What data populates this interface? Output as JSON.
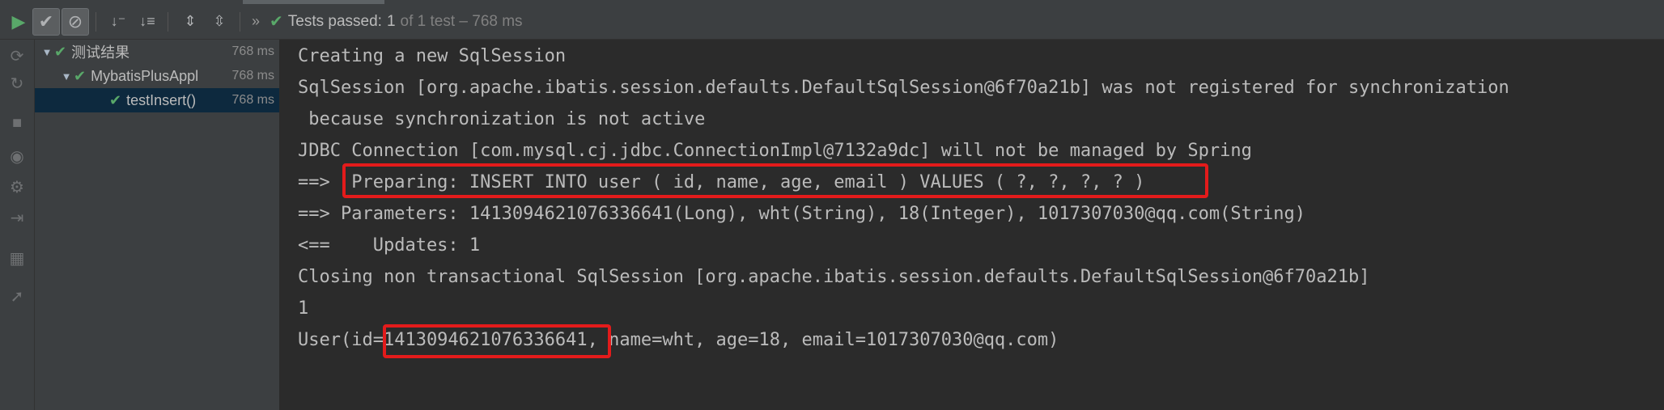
{
  "toolbar": {
    "summary_prefix": "Tests passed: ",
    "passed_count": "1",
    "summary_rest": "of 1 test – 768 ms",
    "chevron": "»"
  },
  "tree": [
    {
      "label": "测试结果",
      "time": "768 ms",
      "indent": 0,
      "expanded": true
    },
    {
      "label": "MybatisPlusAppl",
      "time": "768 ms",
      "indent": 1,
      "expanded": true
    },
    {
      "label": "testInsert()",
      "time": "768 ms",
      "indent": 2,
      "selected": true
    }
  ],
  "console": {
    "lines": [
      "Creating a new SqlSession",
      "SqlSession [org.apache.ibatis.session.defaults.DefaultSqlSession@6f70a21b] was not registered for synchronization",
      " because synchronization is not active",
      "JDBC Connection [com.mysql.cj.jdbc.ConnectionImpl@7132a9dc] will not be managed by Spring",
      "==>  Preparing: INSERT INTO user ( id, name, age, email ) VALUES ( ?, ?, ?, ? )",
      "==> Parameters: 1413094621076336641(Long), wht(String), 18(Integer), 1017307030@qq.com(String)",
      "<==    Updates: 1",
      "Closing non transactional SqlSession [org.apache.ibatis.session.defaults.DefaultSqlSession@6f70a21b]",
      "1",
      "User(id=1413094621076336641, name=wht, age=18, email=1017307030@qq.com)"
    ]
  },
  "colors": {
    "highlight": "#e31b1b",
    "pass": "#59a869"
  },
  "icons": {
    "run": "run-icon",
    "show_passed": "check-icon",
    "show_ignored": "ignore-icon",
    "sort_alpha": "sort-alpha-icon",
    "sort_duration": "sort-duration-icon",
    "expand_all": "expand-all-icon",
    "collapse_all": "collapse-all-icon"
  }
}
